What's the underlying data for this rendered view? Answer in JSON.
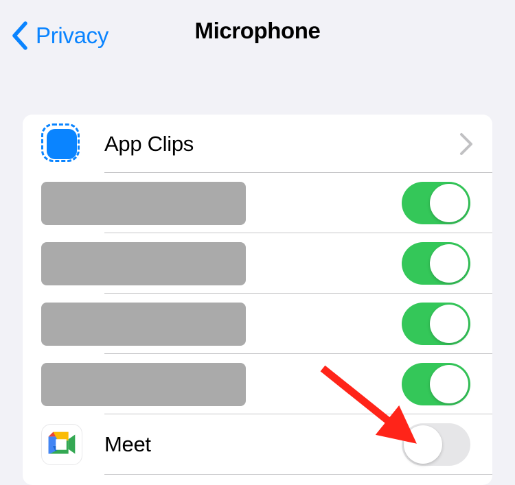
{
  "navbar": {
    "back_label": "Privacy",
    "back_icon": "chevron-left-icon",
    "title": "Microphone"
  },
  "colors": {
    "accent_blue": "#0a84ff",
    "toggle_on_green": "#34c759",
    "toggle_off_gray": "#e6e6e8",
    "page_background": "#f2f2f7",
    "card_background": "#ffffff",
    "separator": "#c6c6c8",
    "redaction_gray": "#aaaaaa",
    "annotation_red": "#ff2419"
  },
  "list": {
    "rows": [
      {
        "id": "app-clips",
        "label": "App Clips",
        "icon": "app-clips-icon",
        "accessory": "chevron-right-icon",
        "redacted": false
      },
      {
        "id": "redacted-1",
        "label": "",
        "icon": "redacted-block",
        "accessory": "toggle-switch",
        "toggle_state": "on",
        "redacted": true
      },
      {
        "id": "redacted-2",
        "label": "",
        "icon": "redacted-block",
        "accessory": "toggle-switch",
        "toggle_state": "on",
        "redacted": true
      },
      {
        "id": "redacted-3",
        "label": "",
        "icon": "redacted-block",
        "accessory": "toggle-switch",
        "toggle_state": "on",
        "redacted": true
      },
      {
        "id": "redacted-4",
        "label": "",
        "icon": "redacted-block",
        "accessory": "toggle-switch",
        "toggle_state": "on",
        "redacted": true
      },
      {
        "id": "meet",
        "label": "Meet",
        "icon": "google-meet-icon",
        "accessory": "toggle-switch",
        "toggle_state": "off",
        "redacted": false
      }
    ]
  },
  "annotation": {
    "type": "arrow",
    "name": "red-arrow-annotation",
    "points_to": "meet-toggle",
    "color": "#ff2419"
  }
}
